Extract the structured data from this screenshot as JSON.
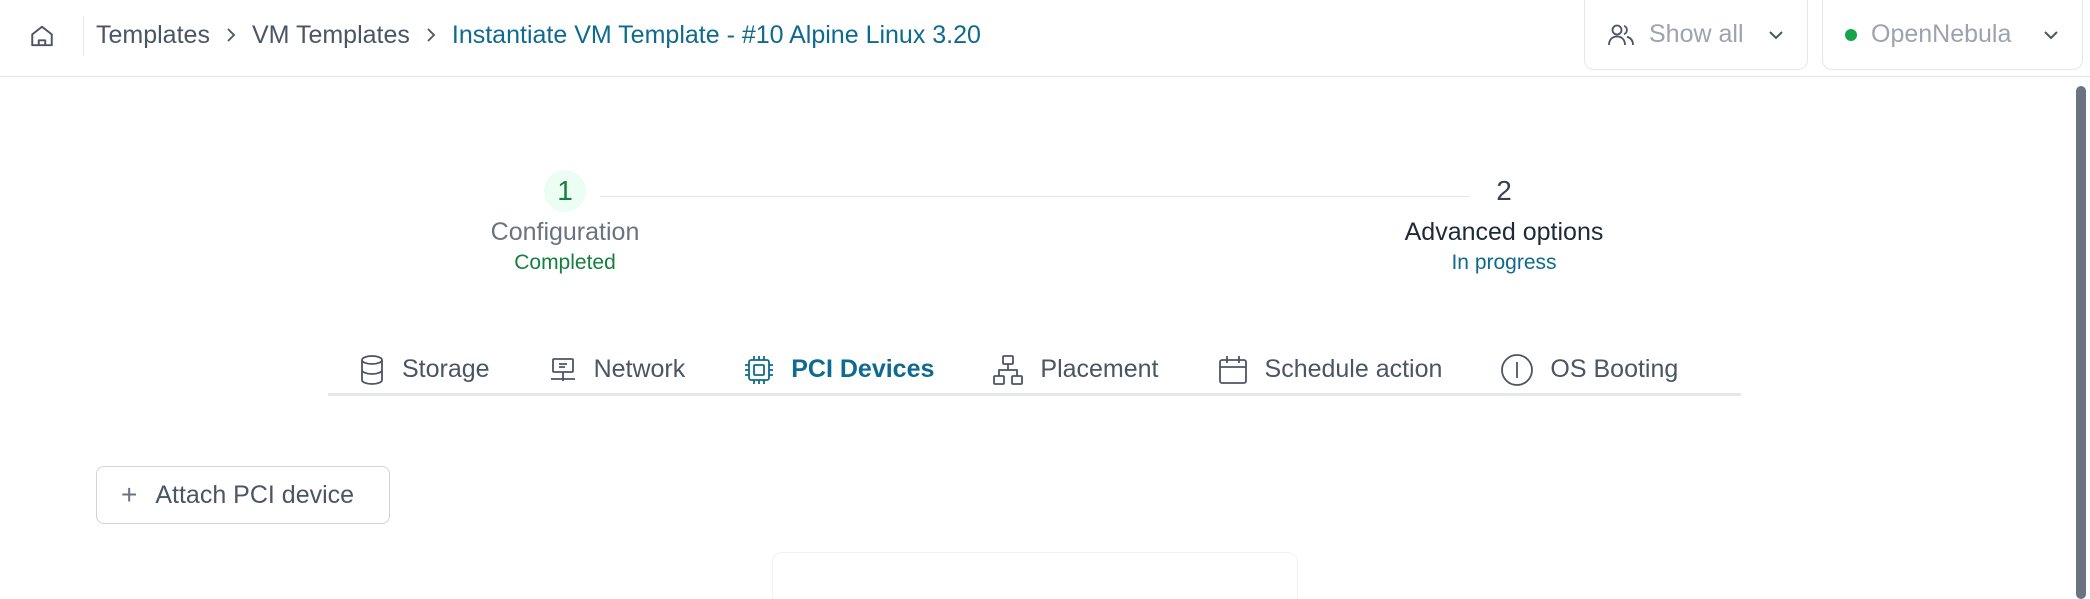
{
  "breadcrumb": {
    "items": [
      "Templates",
      "VM Templates"
    ],
    "current": "Instantiate VM Template - #10 Alpine Linux 3.20"
  },
  "header": {
    "groups_select": {
      "value": "Show all",
      "icon": "users-icon"
    },
    "zone_select": {
      "value": "OpenNebula",
      "status_color": "#16a34a"
    }
  },
  "stepper": {
    "steps": [
      {
        "number": "1",
        "label": "Configuration",
        "status": "Completed"
      },
      {
        "number": "2",
        "label": "Advanced options",
        "status": "In progress"
      }
    ]
  },
  "tabs": [
    {
      "label": "Storage",
      "icon": "database-icon"
    },
    {
      "label": "Network",
      "icon": "network-icon"
    },
    {
      "label": "PCI Devices",
      "icon": "chip-icon",
      "active": true
    },
    {
      "label": "Placement",
      "icon": "hierarchy-icon"
    },
    {
      "label": "Schedule action",
      "icon": "calendar-icon"
    },
    {
      "label": "OS Booting",
      "icon": "info-icon"
    }
  ],
  "pci": {
    "attach_label": "Attach PCI device"
  },
  "colors": {
    "accent": "#0e6a8f",
    "success": "#15803d"
  }
}
